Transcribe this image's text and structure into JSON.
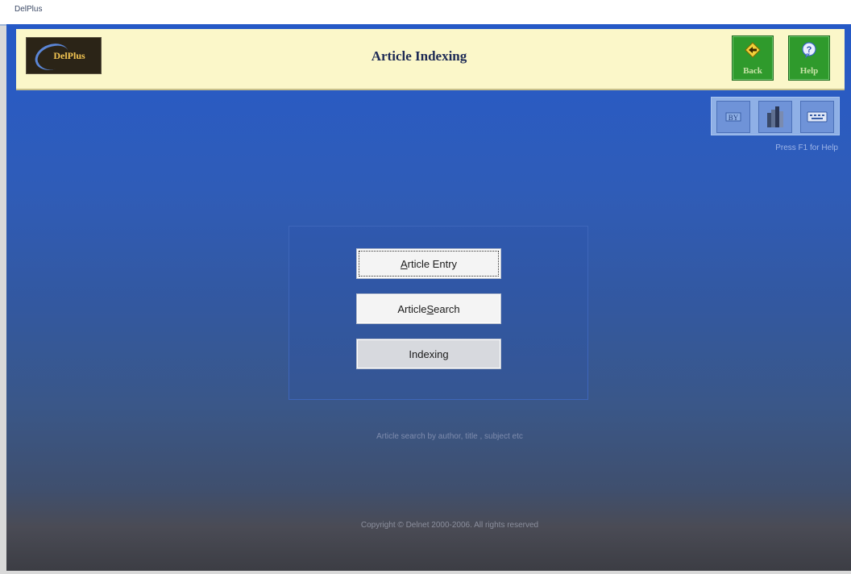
{
  "window": {
    "title": "DelPlus"
  },
  "header": {
    "logo_text": "DelPlus",
    "page_title": "Article Indexing",
    "back_label": "Back",
    "help_label": "Help"
  },
  "toolbar": {
    "icons": [
      "text-tool-icon",
      "books-icon",
      "keyboard-icon"
    ],
    "hint": "Press F1 for Help"
  },
  "menu": {
    "entry_prefix": "",
    "entry_mnemonic": "A",
    "entry_rest": "rticle Entry",
    "search_prefix": "Article ",
    "search_mnemonic": "S",
    "search_rest": "earch",
    "indexing_label": "Indexing"
  },
  "status": {
    "description": "Article search by author, title , subject etc",
    "copyright": "Copyright © Delnet 2000-2006. All rights reserved"
  },
  "colors": {
    "header_bg": "#fbf7c9",
    "accent_green": "#2f9a2c",
    "window_blue": "#2559c6"
  }
}
